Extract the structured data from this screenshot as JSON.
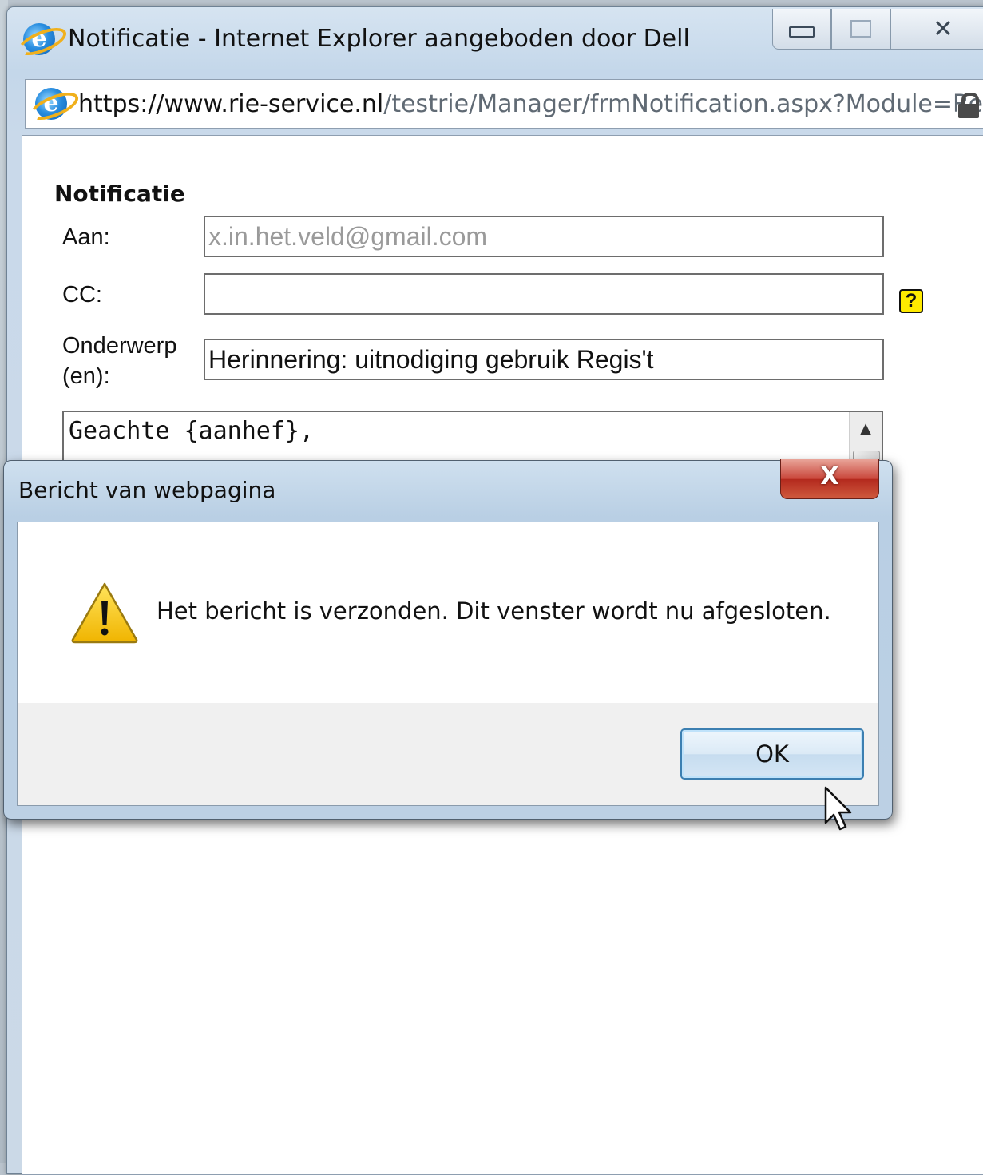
{
  "window": {
    "title": "Notificatie - Internet Explorer aangeboden door Dell",
    "controls": {
      "minimize_icon": "minimize-icon",
      "maximize_icon": "maximize-icon",
      "close_glyph": "✕"
    }
  },
  "address": {
    "url_prefix": "https://www.",
    "url_domain": "rie-service.nl",
    "url_path": "/testrie/Manager/frmNotification.aspx?Module=Re",
    "lock_icon": "lock-icon"
  },
  "form": {
    "section_title": "Notificatie",
    "to_label": "Aan:",
    "to_value": "x.in.het.veld@gmail.com",
    "cc_label": "CC:",
    "cc_value": "",
    "help_label": "?",
    "subject_label_line1": "Onderwerp",
    "subject_label_line2": "(en):",
    "subject_value": "Herinnering: uitnodiging gebruik Regis't",
    "body_text": "Geachte {aanhef},",
    "scroll_up_glyph": "▲"
  },
  "dialog": {
    "title": "Bericht van webpagina",
    "close_glyph": "X",
    "icon": "warning-icon",
    "message": "Het bericht is verzonden. Dit venster wordt nu afgesloten.",
    "ok_label": "OK"
  },
  "colors": {
    "accent_border": "#3c7fb1",
    "warning_yellow": "#f5c400",
    "close_red": "#c9463a",
    "help_yellow": "#ffea00"
  }
}
